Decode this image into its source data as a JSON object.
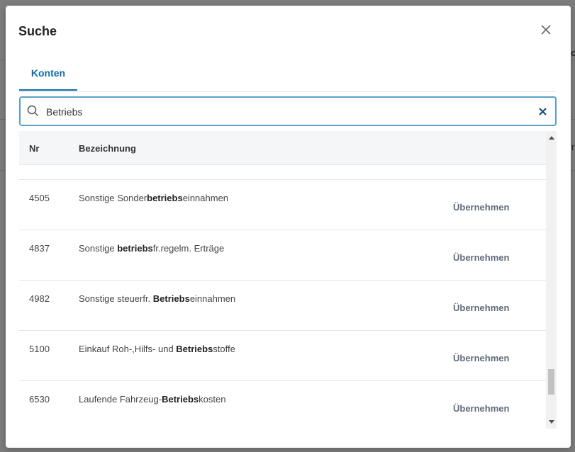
{
  "background": {
    "fragment_1": "c",
    "fragment_2": "r"
  },
  "dialog": {
    "title": "Suche",
    "close_icon": "close-icon",
    "tabs": [
      {
        "label": "Konten",
        "active": true
      }
    ],
    "search": {
      "value": "Betriebs",
      "icon": "search-icon",
      "clear_icon": "clear-icon"
    },
    "table": {
      "columns": {
        "nr": "Nr",
        "desc": "Bezeichnung"
      },
      "rows": [
        {
          "nr": "4505",
          "pre": "Sonstige Sonder",
          "hl": "betriebs",
          "post": "einnahmen",
          "action": "Übernehmen"
        },
        {
          "nr": "4837",
          "pre": "Sonstige ",
          "hl": "betriebs",
          "post": "fr.regelm. Erträge",
          "action": "Übernehmen"
        },
        {
          "nr": "4982",
          "pre": "Sonstige steuerfr. ",
          "hl": "Betriebs",
          "post": "einnahmen",
          "action": "Übernehmen"
        },
        {
          "nr": "5100",
          "pre": "Einkauf Roh-,Hilfs- und ",
          "hl": "Betriebs",
          "post": "stoffe",
          "action": "Übernehmen"
        },
        {
          "nr": "6530",
          "pre": "Laufende Fahrzeug-",
          "hl": "Betriebs",
          "post": "kosten",
          "action": "Übernehmen"
        }
      ]
    }
  },
  "colors": {
    "accent": "#0a6fa8",
    "search_border": "#5aa0c8",
    "action_text": "#5f6b7a"
  }
}
